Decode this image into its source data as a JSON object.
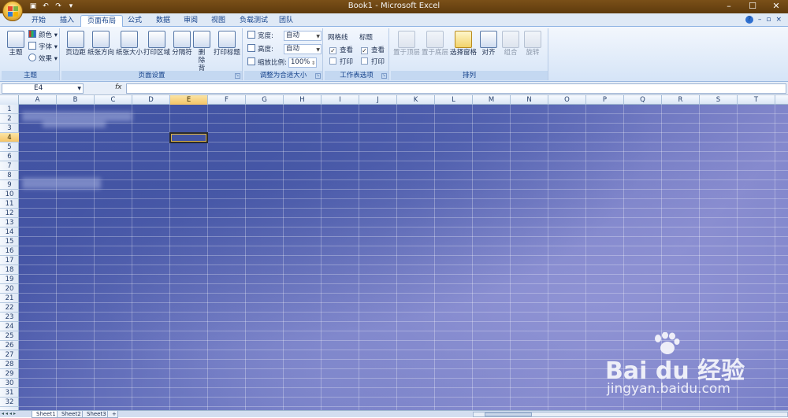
{
  "window": {
    "title": "Book1 - Microsoft Excel",
    "controls": [
      "–",
      "☐",
      "✕"
    ]
  },
  "ribbon_tabs": [
    {
      "label": "开始",
      "active": false
    },
    {
      "label": "插入",
      "active": false
    },
    {
      "label": "页面布局",
      "active": true
    },
    {
      "label": "公式",
      "active": false
    },
    {
      "label": "数据",
      "active": false
    },
    {
      "label": "审阅",
      "active": false
    },
    {
      "label": "视图",
      "active": false
    },
    {
      "label": "负载测试",
      "active": false
    },
    {
      "label": "团队",
      "active": false
    }
  ],
  "ribbon": {
    "theme": {
      "main": "主题",
      "colors": "颜色",
      "fonts": "字体",
      "effects": "效果",
      "group": "主题"
    },
    "page_setup": {
      "margins": "页边距",
      "orientation": "纸张方向",
      "size": "纸张大小",
      "print_area": "打印区域",
      "breaks": "分隔符",
      "background": "删除背景",
      "print_titles": "打印标题",
      "group": "页面设置"
    },
    "scale": {
      "width_label": "宽度:",
      "width_value": "自动",
      "height_label": "高度:",
      "height_value": "自动",
      "scale_label": "缩放比例:",
      "scale_value": "100%",
      "group": "调整为合适大小"
    },
    "sheet_options": {
      "gridlines": "网格线",
      "headings": "标题",
      "view": "查看",
      "print": "打印",
      "gridlines_view": true,
      "gridlines_print": false,
      "headings_view": true,
      "headings_print": false,
      "group": "工作表选项"
    },
    "arrange": {
      "bring_front": "置于顶层",
      "send_back": "置于底层",
      "selection_pane": "选择窗格",
      "align": "对齐",
      "group_btn": "组合",
      "rotate": "旋转",
      "group": "排列"
    }
  },
  "formula_bar": {
    "name_box": "E4",
    "fx": "fx",
    "value": ""
  },
  "grid": {
    "columns": [
      "A",
      "B",
      "C",
      "D",
      "E",
      "F",
      "G",
      "H",
      "I",
      "J",
      "K",
      "L",
      "M",
      "N",
      "O",
      "P",
      "Q",
      "R",
      "S",
      "T"
    ],
    "rows": [
      "1",
      "2",
      "3",
      "4",
      "5",
      "6",
      "7",
      "8",
      "9",
      "10",
      "11",
      "12",
      "13",
      "14",
      "15",
      "16",
      "17",
      "18",
      "19",
      "20",
      "21",
      "22",
      "23",
      "24",
      "25",
      "26",
      "27",
      "28",
      "29",
      "30",
      "31",
      "32"
    ],
    "selected_column": "E",
    "selected_row": "4",
    "sheet_background_colors": [
      "#3f4ea0",
      "#5a68b6",
      "#8589cd"
    ]
  },
  "sheet_tabs": [
    "Sheet1",
    "Sheet2",
    "Sheet3"
  ],
  "watermark": {
    "brand": "Bai du 经验",
    "url": "jingyan.baidu.com"
  }
}
